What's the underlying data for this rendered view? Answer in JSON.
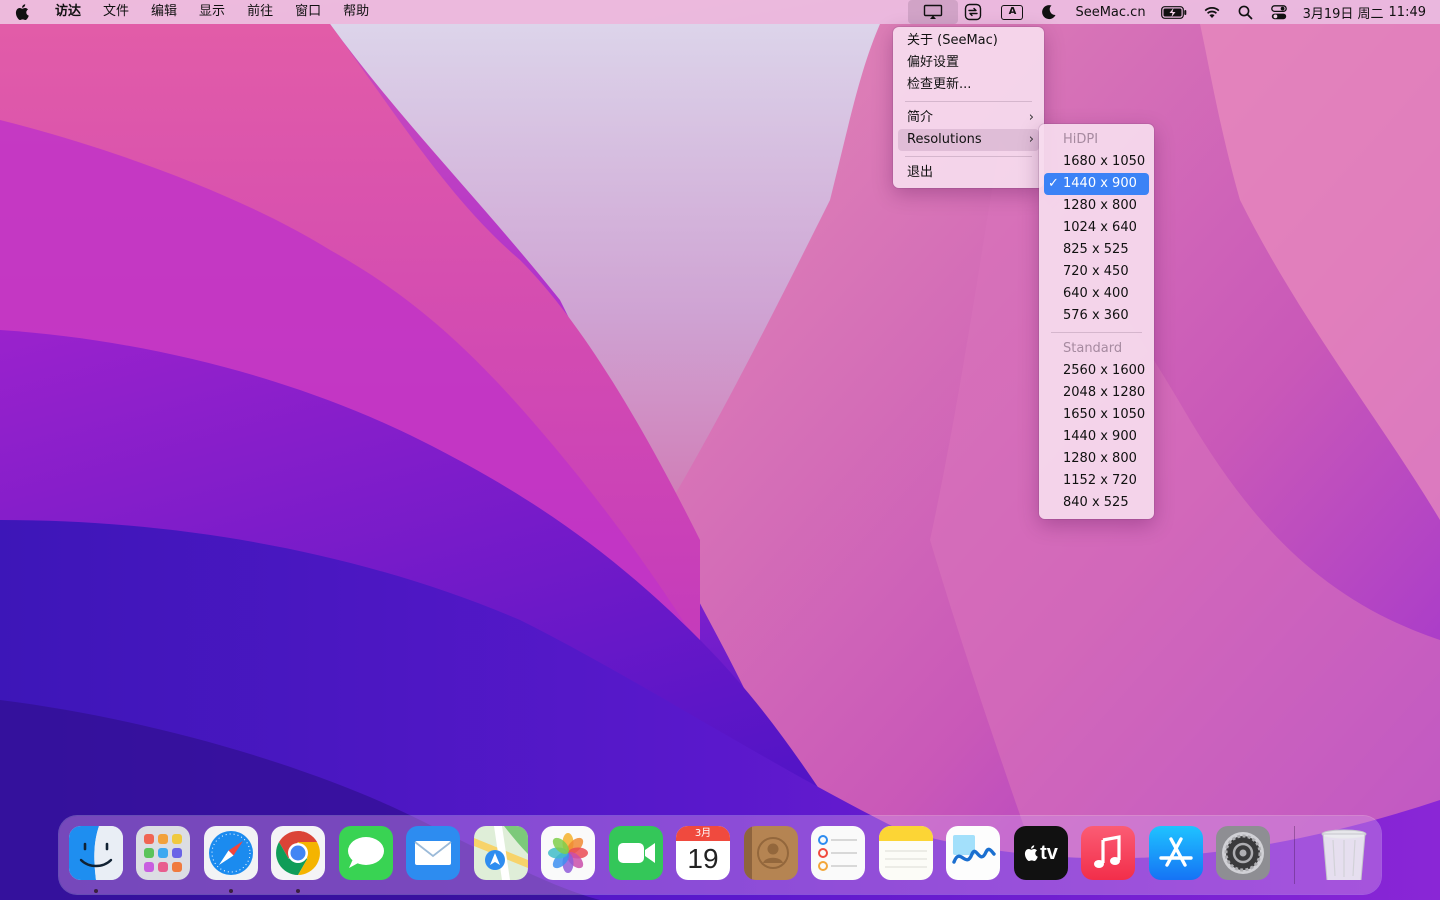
{
  "menubar": {
    "apple_icon": "apple-logo-icon",
    "app_name": "访达",
    "menus": [
      "文件",
      "编辑",
      "显示",
      "前往",
      "窗口",
      "帮助"
    ],
    "status_icons": [
      "display-icon",
      "sync-icon",
      "input-method-icon",
      "focus-moon-icon",
      "battery-icon",
      "wifi-icon",
      "spotlight-search-icon",
      "control-center-icon"
    ],
    "input_method_label": "A",
    "site_label": "SeeMac.cn",
    "date": "3月19日 周二",
    "time": "11:49"
  },
  "app_menu": {
    "items": [
      {
        "label": "关于 (SeeMac)"
      },
      {
        "label": "偏好设置"
      },
      {
        "label": "检查更新..."
      },
      {
        "label": "简介",
        "submenu": true
      },
      {
        "label": "Resolutions",
        "submenu": true,
        "highlighted": true
      },
      {
        "label": "退出"
      }
    ]
  },
  "resolutions_menu": {
    "hidpi_header": "HiDPI",
    "hidpi": [
      "1680 x 1050",
      "1440 x 900",
      "1280 x 800",
      "1024 x 640",
      "825 x 525",
      "720 x 450",
      "640 x 400",
      "576 x 360"
    ],
    "selected": "1440 x 900",
    "standard_header": "Standard",
    "standard": [
      "2560 x 1600",
      "2048 x 1280",
      "1650 x 1050",
      "1440 x 900",
      "1280 x 800",
      "1152 x 720",
      "840 x 525"
    ]
  },
  "dock": {
    "apps": [
      {
        "name": "finder",
        "running": true
      },
      {
        "name": "launchpad",
        "running": false
      },
      {
        "name": "safari",
        "running": true
      },
      {
        "name": "chrome",
        "running": true
      },
      {
        "name": "messages",
        "running": false
      },
      {
        "name": "mail",
        "running": false
      },
      {
        "name": "maps",
        "running": false
      },
      {
        "name": "photos",
        "running": false
      },
      {
        "name": "facetime",
        "running": false
      },
      {
        "name": "calendar",
        "running": false
      },
      {
        "name": "contacts",
        "running": false
      },
      {
        "name": "reminders",
        "running": false
      },
      {
        "name": "notes",
        "running": false
      },
      {
        "name": "freeform",
        "running": false
      },
      {
        "name": "tv",
        "running": false
      },
      {
        "name": "music",
        "running": false
      },
      {
        "name": "app-store",
        "running": false
      },
      {
        "name": "system-settings",
        "running": false
      }
    ],
    "calendar": {
      "month": "3月",
      "day": "19"
    },
    "tv_label": "tv",
    "trash": "trash-icon"
  }
}
